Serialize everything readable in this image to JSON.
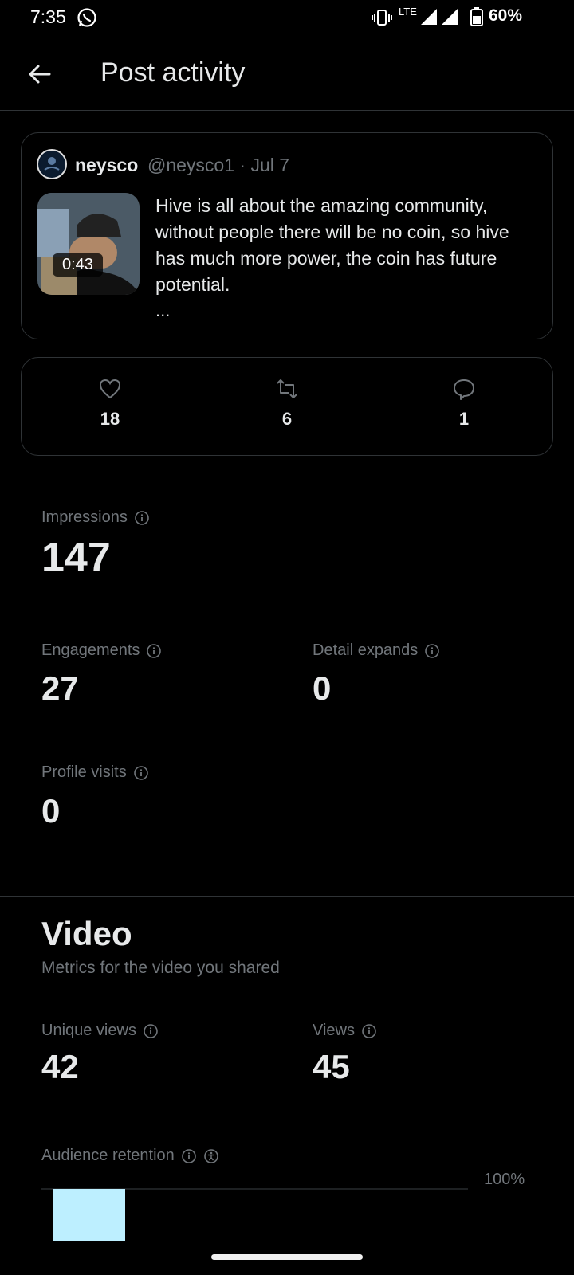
{
  "status": {
    "time": "7:35",
    "network": "LTE",
    "battery": "60%"
  },
  "header": {
    "title": "Post activity"
  },
  "post": {
    "author_name": "neysco",
    "author_meta": "@neysco1 · Jul 7",
    "duration": "0:43",
    "text": "Hive is all about the amazing community, without people there will be no coin, so hive has much more power, the coin has future potential.",
    "ellipsis": "..."
  },
  "engagement": {
    "likes": "18",
    "reposts": "6",
    "replies": "1"
  },
  "metrics": {
    "impressions_label": "Impressions",
    "impressions_value": "147",
    "engagements_label": "Engagements",
    "engagements_value": "27",
    "detail_expands_label": "Detail expands",
    "detail_expands_value": "0",
    "profile_visits_label": "Profile visits",
    "profile_visits_value": "0"
  },
  "video": {
    "title": "Video",
    "subtitle": "Metrics for the video you shared",
    "unique_views_label": "Unique views",
    "unique_views_value": "42",
    "views_label": "Views",
    "views_value": "45",
    "retention_label": "Audience retention",
    "retention_axis_label": "100%"
  },
  "chart_data": {
    "type": "bar",
    "title": "Audience retention",
    "categories": [
      ""
    ],
    "values": [
      100
    ],
    "ylim": [
      0,
      100
    ],
    "bar_color": "#bdefff"
  },
  "colors": {
    "background": "#000000",
    "border": "#2f3336",
    "muted": "#71767b",
    "text": "#e7e9ea"
  }
}
